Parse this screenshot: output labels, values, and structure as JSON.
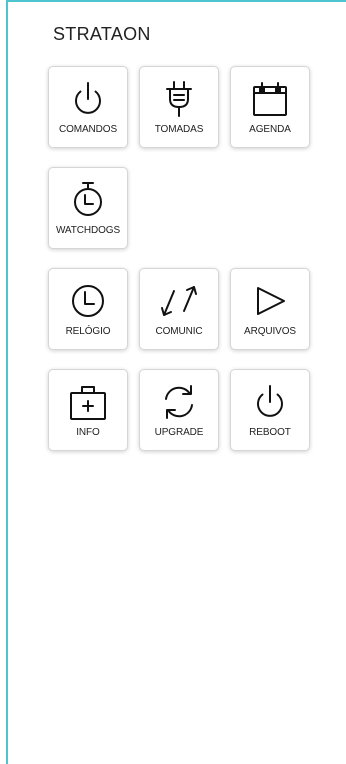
{
  "app": {
    "title": "STRATAON",
    "accent_color": "#4fc6cf"
  },
  "tiles": [
    {
      "label": "COMANDOS",
      "icon": "power-icon"
    },
    {
      "label": "TOMADAS",
      "icon": "plug-icon"
    },
    {
      "label": "AGENDA",
      "icon": "calendar-icon"
    },
    {
      "label": "WATCHDOGS",
      "icon": "stopwatch-icon"
    },
    {
      "label": "RELÓGIO",
      "icon": "clock-icon"
    },
    {
      "label": "COMUNIC",
      "icon": "transfer-arrows-icon"
    },
    {
      "label": "ARQUIVOS",
      "icon": "play-icon"
    },
    {
      "label": "INFO",
      "icon": "first-aid-kit-icon"
    },
    {
      "label": "UPGRADE",
      "icon": "refresh-icon"
    },
    {
      "label": "REBOOT",
      "icon": "power-icon"
    }
  ]
}
